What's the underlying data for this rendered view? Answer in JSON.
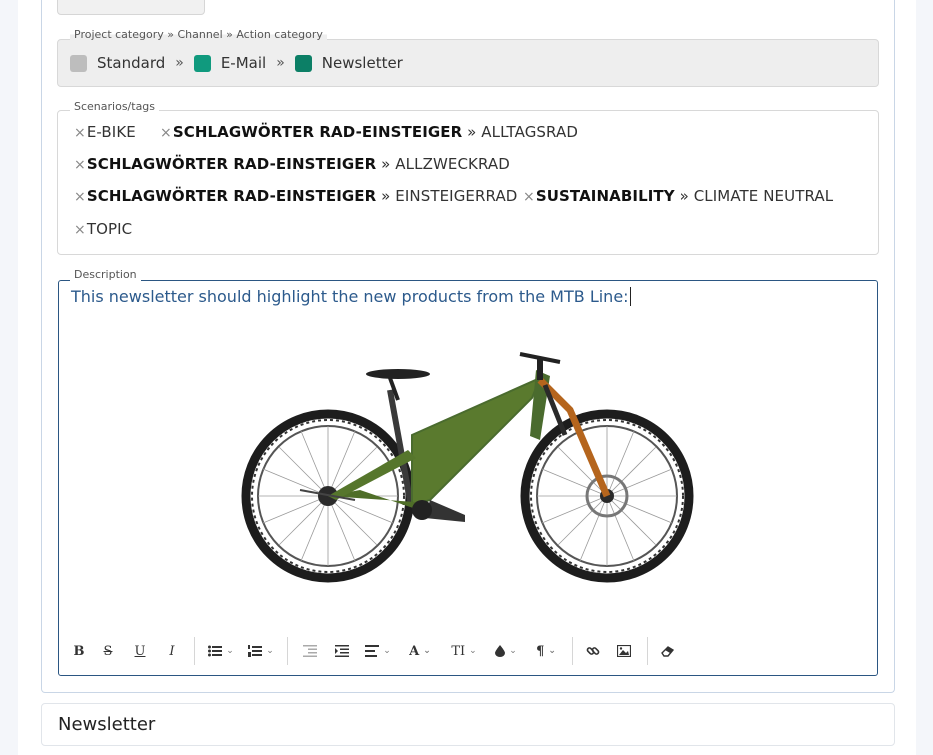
{
  "category": {
    "legend": "Project category » Channel » Action category",
    "separator": "»",
    "items": [
      {
        "label": "Standard",
        "color": "#bdbdbd"
      },
      {
        "label": "E-Mail",
        "color": "#109a7e"
      },
      {
        "label": "Newsletter",
        "color": "#0c7f66"
      }
    ]
  },
  "tags": {
    "legend": "Scenarios/tags",
    "remove_glyph": "×",
    "items": [
      {
        "group": "",
        "value": "E-BIKE"
      },
      {
        "group": "SCHLAGWÖRTER RAD-EINSTEIGER",
        "value": "» ALLTAGSRAD"
      },
      {
        "group": "SCHLAGWÖRTER RAD-EINSTEIGER",
        "value": "» ALLZWECKRAD"
      },
      {
        "group": "SCHLAGWÖRTER RAD-EINSTEIGER",
        "value": "» EINSTEIGERRAD"
      },
      {
        "group": "SUSTAINABILITY",
        "value": "» CLIMATE NEUTRAL"
      },
      {
        "group": "",
        "value": "TOPIC"
      }
    ]
  },
  "description": {
    "legend": "Description",
    "text": "This newsletter should highlight the new products from the MTB Line:"
  },
  "toolbar": {
    "bold": "B",
    "strike": "S",
    "underline": "U",
    "italic": "I",
    "font": "A",
    "text_size": "TI",
    "paragraph": "¶"
  },
  "section_title": "Newsletter",
  "colors": {
    "accent_border": "#2b5682",
    "text_blue": "#2c5a8c",
    "frame": "#4a6b2e",
    "fork": "#b5651d"
  }
}
